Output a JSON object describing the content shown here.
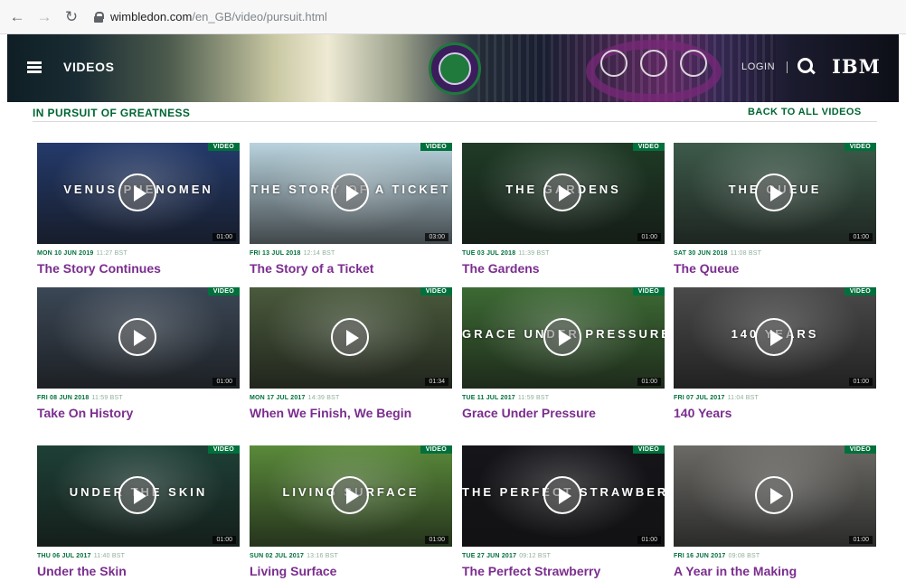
{
  "browser": {
    "url_host": "wimbledon.com",
    "url_path": "/en_GB/video/pursuit.html"
  },
  "header": {
    "title": "VIDEOS",
    "login": "LOGIN",
    "sponsor": "IBM"
  },
  "section": {
    "title": "IN PURSUIT OF GREATNESS",
    "back_link": "BACK TO ALL VIDEOS"
  },
  "badge_label": "VIDEO",
  "cards": [
    {
      "date": "MON 10 JUN 2019",
      "time": "11:27 BST",
      "title": "The Story Continues",
      "overlay": "VENUS PHENOMEN",
      "duration": "01:00",
      "thumb_color": "#243a6b"
    },
    {
      "date": "FRI 13 JUL 2018",
      "time": "12:14 BST",
      "title": "The Story of a Ticket",
      "overlay": "THE STORY OF A TICKET",
      "duration": "03:00",
      "thumb_color": "#b9d3de"
    },
    {
      "date": "TUE 03 JUL 2018",
      "time": "11:39 BST",
      "title": "The Gardens",
      "overlay": "THE GARDENS",
      "duration": "01:00",
      "thumb_color": "#1f3b26"
    },
    {
      "date": "SAT 30 JUN 2018",
      "time": "11:08 BST",
      "title": "The Queue",
      "overlay": "THE QUEUE",
      "duration": "01:00",
      "thumb_color": "#3d5a4a"
    },
    {
      "date": "FRI 08 JUN 2018",
      "time": "11:59 BST",
      "title": "Take On History",
      "overlay": "",
      "duration": "01:00",
      "thumb_color": "#3b4756"
    },
    {
      "date": "MON 17 JUL 2017",
      "time": "14:39 BST",
      "title": "When We Finish, We Begin",
      "overlay": "",
      "duration": "01:34",
      "thumb_color": "#4a5a3c"
    },
    {
      "date": "TUE 11 JUL 2017",
      "time": "11:59 BST",
      "title": "Grace Under Pressure",
      "overlay": "GRACE UNDER PRESSURE",
      "duration": "01:00",
      "thumb_color": "#3d6a34"
    },
    {
      "date": "FRI 07 JUL 2017",
      "time": "11:04 BST",
      "title": "140 Years",
      "overlay": "140 YEARS",
      "duration": "01:00",
      "thumb_color": "#4a4a4a"
    },
    {
      "date": "THU 06 JUL 2017",
      "time": "11:40 BST",
      "title": "Under the Skin",
      "overlay": "UNDER THE SKIN",
      "duration": "01:00",
      "thumb_color": "#1e4036"
    },
    {
      "date": "SUN 02 JUL 2017",
      "time": "13:16 BST",
      "title": "Living Surface",
      "overlay": "LIVING SURFACE",
      "duration": "01:00",
      "thumb_color": "#5a8a3a"
    },
    {
      "date": "TUE 27 JUN 2017",
      "time": "09:12 BST",
      "title": "The Perfect Strawberry",
      "overlay": "THE PERFECT STRAWBERRY",
      "duration": "01:00",
      "thumb_color": "#15151a"
    },
    {
      "date": "FRI 16 JUN 2017",
      "time": "09:08 BST",
      "title": "A Year in the Making",
      "overlay": "",
      "duration": "01:00",
      "thumb_color": "#6b6a66"
    }
  ]
}
